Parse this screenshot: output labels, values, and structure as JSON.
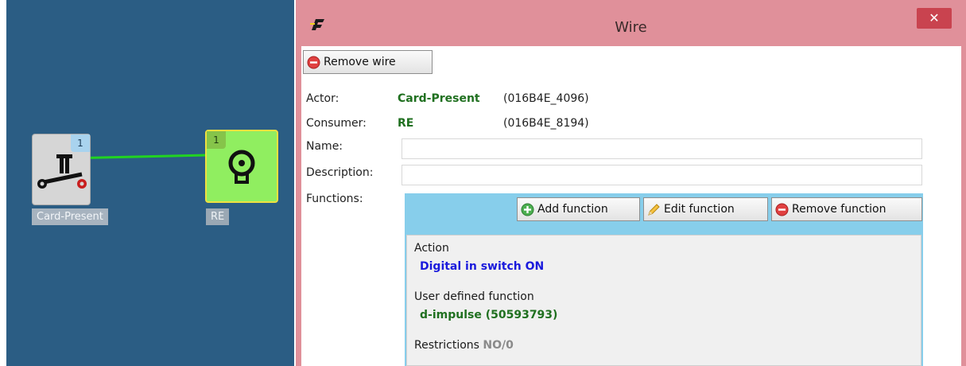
{
  "canvas": {
    "actor_node": {
      "label": "Card-Present",
      "badge": "1",
      "icon": "switch-icon"
    },
    "consumer_node": {
      "label": "RE",
      "badge": "1",
      "icon": "relay-icon"
    },
    "wire_color": "#21d321",
    "background": "#2b5d84"
  },
  "dialog": {
    "title": "Wire",
    "close_label": "✕",
    "remove_wire_label": "Remove wire",
    "actor": {
      "label": "Actor:",
      "name": "Card-Present",
      "id": "(016B4E_4096)"
    },
    "consumer": {
      "label": "Consumer:",
      "name": "RE",
      "id": "(016B4E_8194)"
    },
    "name": {
      "label": "Name:",
      "value": ""
    },
    "description": {
      "label": "Description:",
      "value": ""
    },
    "functions": {
      "label": "Functions:",
      "add_label": "Add function",
      "edit_label": "Edit function",
      "remove_label": "Remove function",
      "item": {
        "action_label": "Action",
        "action_value": "Digital in switch ON",
        "udf_label": "User defined function",
        "udf_value": "d-impulse (50593793)",
        "restrictions_label": "Restrictions",
        "restrictions_value": "NO/0"
      }
    }
  },
  "colors": {
    "titlebar": "#e0909a",
    "close": "#c9434f",
    "panel": "#87ceeb",
    "accent_green": "#207020",
    "accent_blue": "#1a1adc"
  }
}
